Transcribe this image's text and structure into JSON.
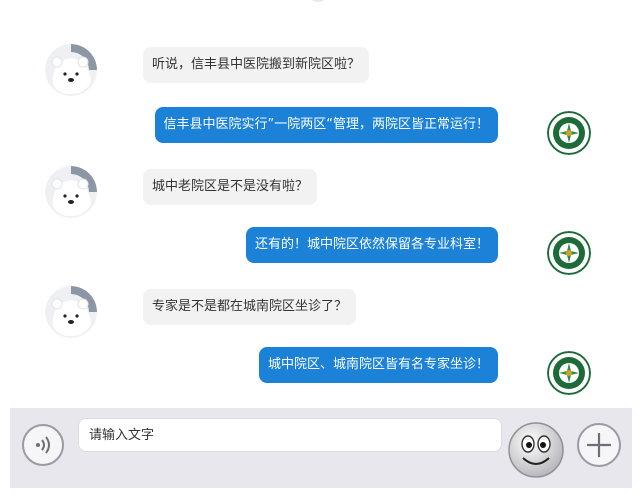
{
  "messages": [
    {
      "side": "in",
      "text": "听说，信丰县中医院搬到新院区啦？"
    },
    {
      "side": "out",
      "text": "信丰县中医院实行”一院两区“管理，两院区皆正常运行！"
    },
    {
      "side": "in",
      "text": "城中老院区是不是没有啦？"
    },
    {
      "side": "out",
      "text": "还有的！城中院区依然保留各专业科室！"
    },
    {
      "side": "in",
      "text": "专家是不是都在城南院区坐诊了？"
    },
    {
      "side": "out",
      "text": "城中院区、城南院区皆有名专家坐诊！"
    }
  ],
  "input": {
    "placeholder": "请输入文字",
    "value": ""
  },
  "icons": {
    "user_avatar": "polar-bear-icon",
    "hospital_avatar": "hospital-emblem-icon",
    "voice": "voice-wave-icon",
    "emoji": "smiley-face-icon",
    "plus": "plus-icon"
  },
  "colors": {
    "out_bubble": "#1b82d8",
    "in_bubble": "#f2f2f2",
    "bar": "#e9e7ee"
  }
}
